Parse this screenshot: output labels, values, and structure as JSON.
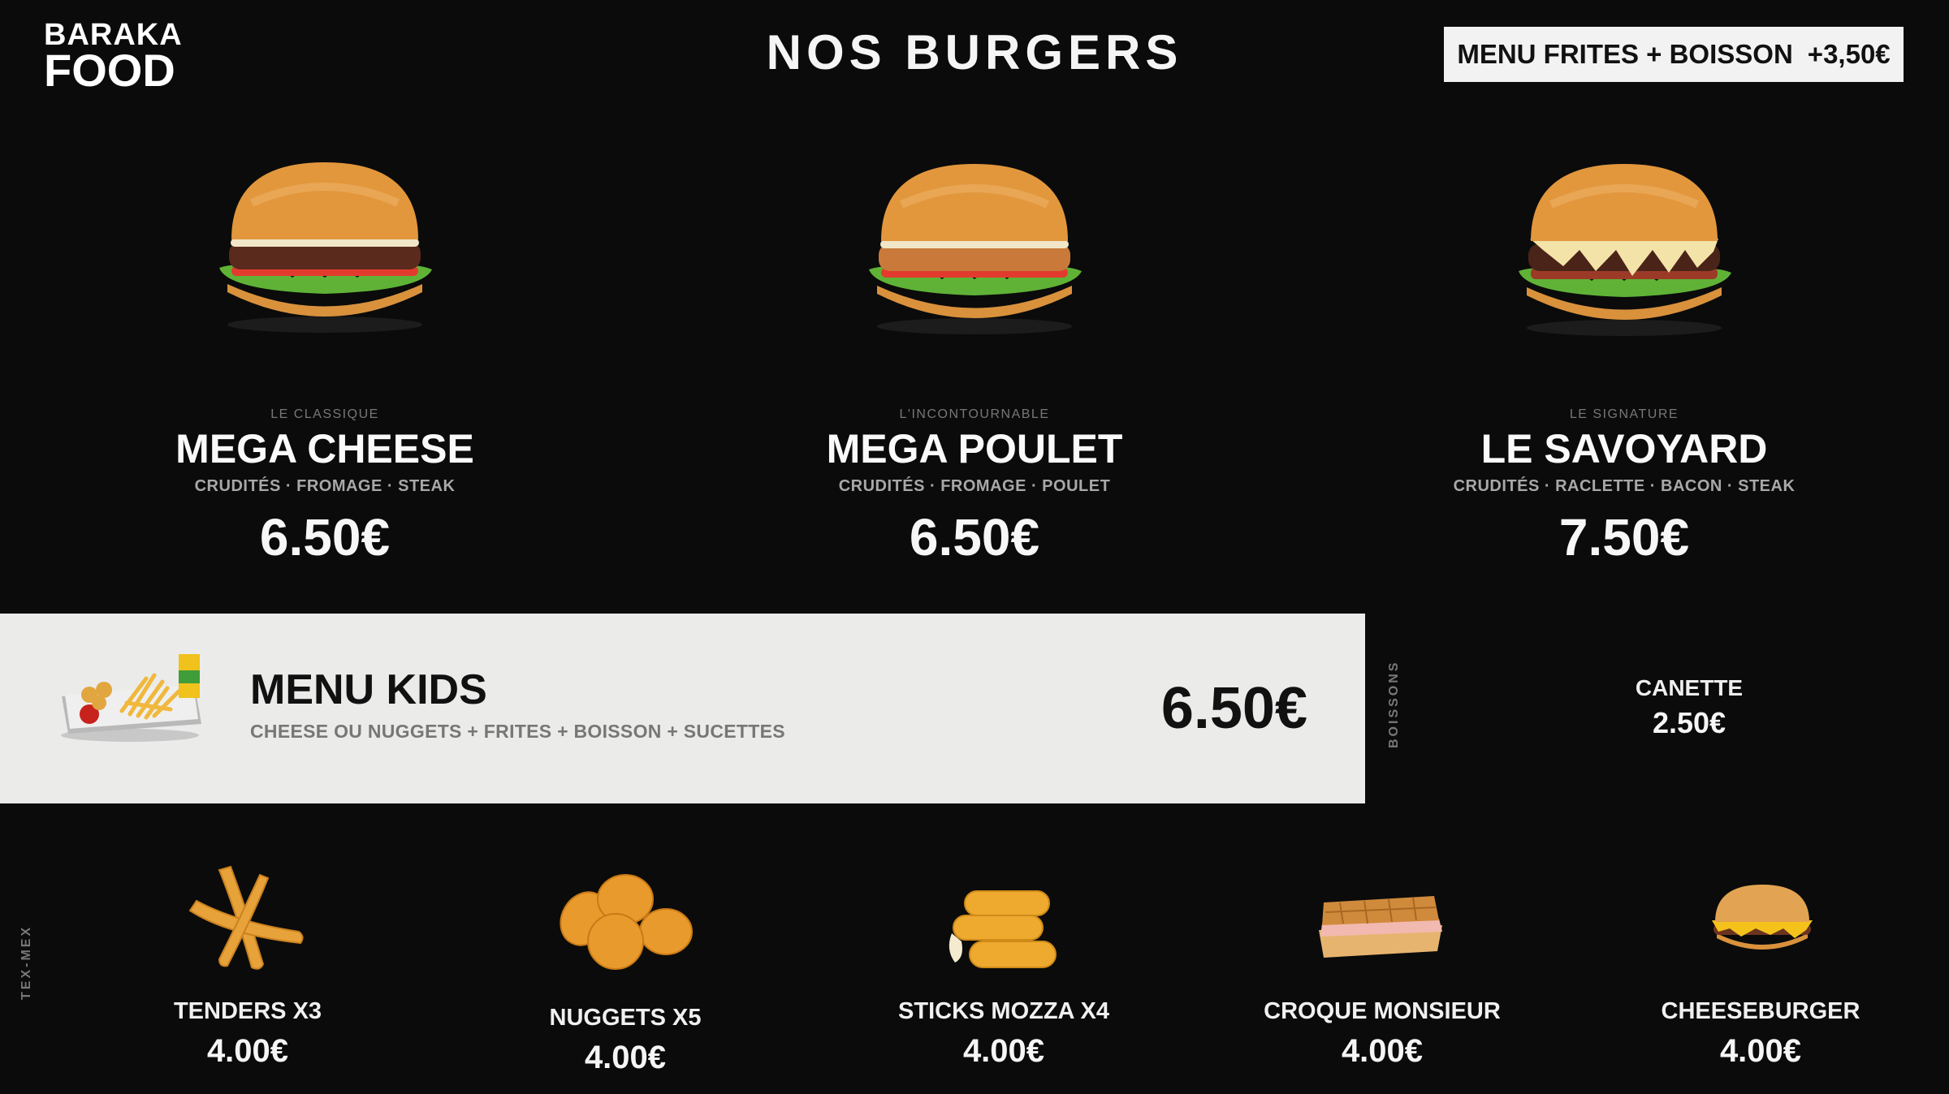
{
  "brand": {
    "line1": "BARAKA",
    "line2": "FOOD"
  },
  "header": {
    "title": "NOS BURGERS",
    "combo_label": "MENU FRITES + BOISSON",
    "combo_price": "+3,50€"
  },
  "burgers": [
    {
      "tag": "LE CLASSIQUE",
      "name": "MEGA CHEESE",
      "ingredients": "CRUDITÉS · FROMAGE · STEAK",
      "price": "6.50€"
    },
    {
      "tag": "L'INCONTOURNABLE",
      "name": "MEGA POULET",
      "ingredients": "CRUDITÉS · FROMAGE · POULET",
      "price": "6.50€"
    },
    {
      "tag": "LE SIGNATURE",
      "name": "LE SAVOYARD",
      "ingredients": "CRUDITÉS · RACLETTE · BACON · STEAK",
      "price": "7.50€"
    }
  ],
  "kids": {
    "name": "MENU KIDS",
    "description": "CHEESE OU NUGGETS + FRITES + BOISSON + SUCETTES",
    "price": "6.50€"
  },
  "drinks": {
    "section_label": "BOISSONS",
    "items": [
      {
        "name": "CANETTE",
        "price": "2.50€"
      }
    ]
  },
  "texmex": {
    "section_label": "TEX-MEX",
    "items": [
      {
        "name": "TENDERS X3",
        "price": "4.00€"
      },
      {
        "name": "NUGGETS X5",
        "price": "4.00€"
      },
      {
        "name": "STICKS MOZZA X4",
        "price": "4.00€"
      },
      {
        "name": "CROQUE MONSIEUR",
        "price": "4.00€"
      },
      {
        "name": "CHEESEBURGER",
        "price": "4.00€"
      }
    ]
  }
}
